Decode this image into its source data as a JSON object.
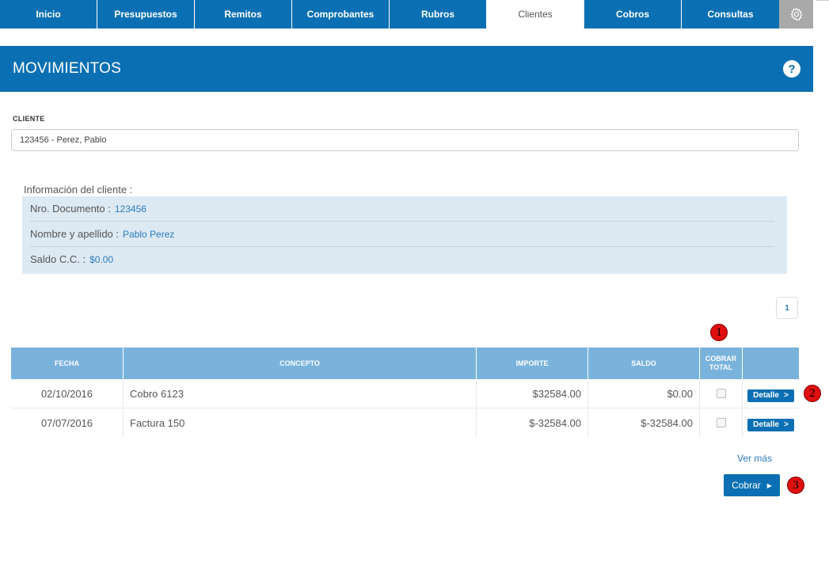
{
  "nav": {
    "tabs": [
      {
        "label": "Inicio"
      },
      {
        "label": "Presupuestos"
      },
      {
        "label": "Remitos"
      },
      {
        "label": "Comprobantes"
      },
      {
        "label": "Rubros"
      },
      {
        "label": "Clientes",
        "active": true
      },
      {
        "label": "Cobros"
      },
      {
        "label": "Consultas"
      }
    ],
    "settings_icon": "gear-icon"
  },
  "header": {
    "title": "MOVIMIENTOS",
    "help_label": "?"
  },
  "client": {
    "label": "CLIENTE",
    "value": "123456 - Perez, Pablo"
  },
  "info": {
    "title": "Información del cliente :",
    "rows": [
      {
        "label": "Nro. Documento :",
        "value": "123456"
      },
      {
        "label": "Nombre y apellido :",
        "value": "Pablo Perez"
      },
      {
        "label": "Saldo C.C. :",
        "value": "$0.00"
      }
    ]
  },
  "pagination": {
    "current": "1"
  },
  "table": {
    "headers": {
      "fecha": "FECHA",
      "concepto": "CONCEPTO",
      "importe": "IMPORTE",
      "saldo": "SALDO",
      "cobrar_line1": "COBRAR",
      "cobrar_line2": "TOTAL"
    },
    "rows": [
      {
        "fecha": "02/10/2016",
        "concepto": "Cobro 6123",
        "importe": "$32584.00",
        "saldo": "$0.00",
        "detalle": "Detalle",
        "detalle_arrow": ">"
      },
      {
        "fecha": "07/07/2016",
        "concepto": "Factura 150",
        "importe": "$-32584.00",
        "saldo": "$-32584.00",
        "detalle": "Detalle",
        "detalle_arrow": ">"
      }
    ]
  },
  "actions": {
    "ver_mas": "Ver más",
    "cobrar": "Cobrar",
    "cobrar_arrow": "▶"
  },
  "markers": [
    "1",
    "2",
    "3"
  ],
  "colors": {
    "primary": "#0b70b3",
    "table_header": "#79b3dc",
    "info_bg": "#dde9f3",
    "link": "#2d7bbf",
    "marker": "#e01010"
  }
}
